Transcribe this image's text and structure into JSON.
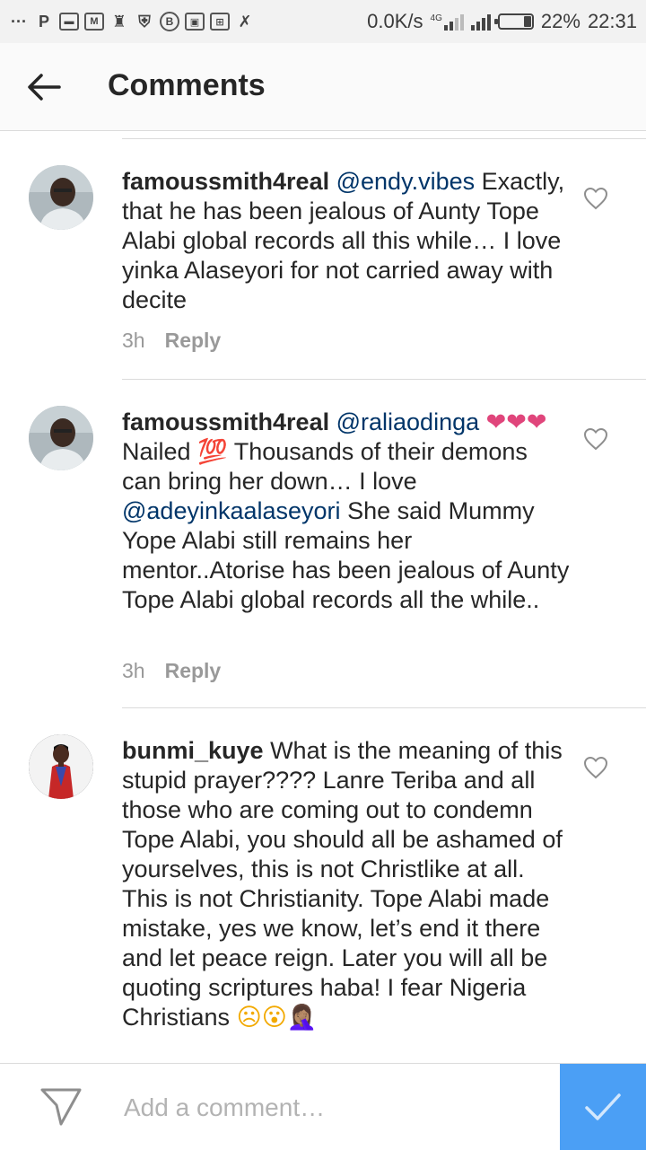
{
  "status_bar": {
    "net_speed": "0.0K/s",
    "network_type": "4G",
    "battery": "22%",
    "battery_level": 0.22,
    "time": "22:31"
  },
  "header": {
    "title": "Comments"
  },
  "comments": [
    {
      "username": "famoussmith4real",
      "mention": "@endy.vibes",
      "text": "Exactly, that he has been jealous of Aunty Tope Alabi global records all this while… I love yinka Alaseyori for not carried away with decite",
      "time": "3h",
      "reply_label": "Reply"
    },
    {
      "username": "famoussmith4real",
      "mention": "@raliaodinga",
      "emoji_prefix": "❤❤❤",
      "text_part1": "Nailed",
      "emoji_100": "💯",
      "text_part2": "Thousands of their demons can bring her down… I love",
      "mention2": "@adeyinkaalaseyori",
      "text_part3": "She said Mummy Yope Alabi still remains her mentor..Atorise has been jealous of Aunty Tope Alabi global records all the while..",
      "time": "3h",
      "reply_label": "Reply"
    },
    {
      "username": "bunmi_kuye",
      "text": "What is the meaning of this stupid prayer???? Lanre Teriba and all those who are coming out to condemn Tope Alabi, you should all be ashamed of yourselves, this is not Christlike at all. This is not Christianity. Tope Alabi made mistake, yes we know, let’s end it there and let peace reign. Later you will all be quoting scriptures haba! I fear Nigeria Christians",
      "emoji_suffix": "☹😮🤦🏽‍♀"
    }
  ],
  "composer": {
    "placeholder": "Add a comment…"
  },
  "colors": {
    "accent": "#4b9ff5",
    "mention": "#003569",
    "secondary_text": "#999999",
    "heart_emoji": "#e0457b"
  }
}
